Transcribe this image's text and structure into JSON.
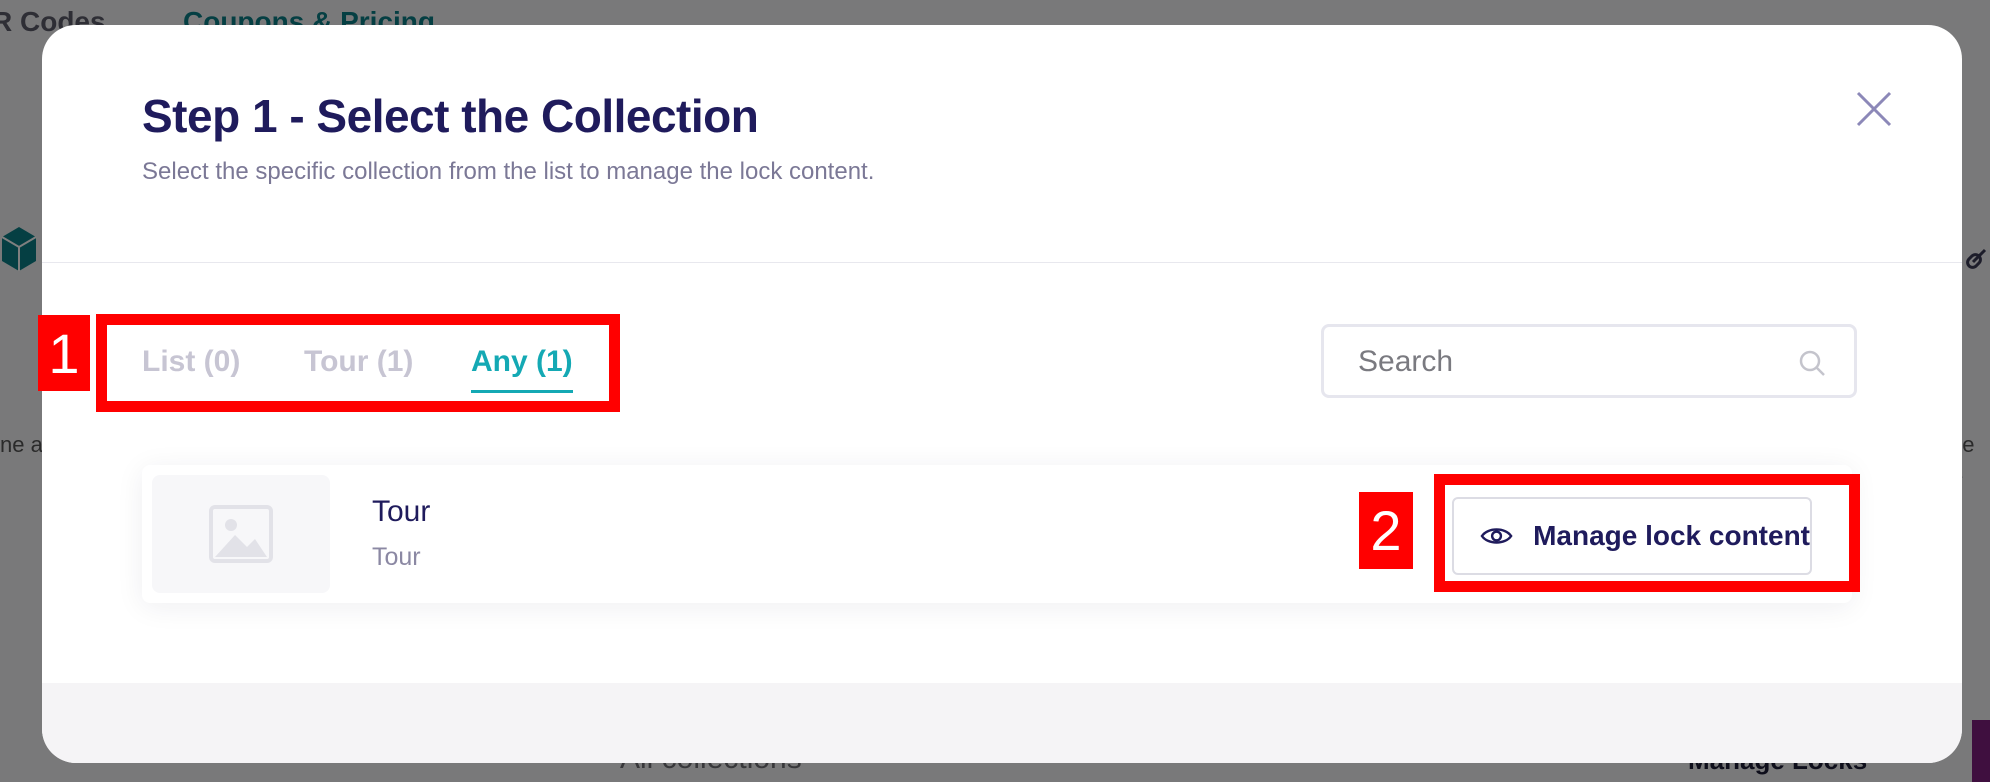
{
  "background": {
    "tabs": [
      "R Codes",
      "Coupons & Pricing"
    ],
    "bottom_search_placeholder": "All collections",
    "manage_locks_label": "Manage Locks",
    "side_text_left": "ne ap",
    "side_text_right": "ne a"
  },
  "modal": {
    "title": "Step 1 - Select the Collection",
    "subtitle": "Select the specific collection from the list to manage the lock content.",
    "close_icon": "close-icon",
    "tabs": [
      {
        "label": "List (0)",
        "active": false
      },
      {
        "label": "Tour (1)",
        "active": false
      },
      {
        "label": "Any (1)",
        "active": true
      }
    ],
    "search": {
      "placeholder": "Search",
      "value": ""
    },
    "collections": [
      {
        "title": "Tour",
        "subtitle": "Tour",
        "thumbnail_icon": "image-placeholder-icon",
        "action_label": "Manage lock content",
        "action_icon": "eye-icon"
      }
    ]
  },
  "annotations": [
    "1",
    "2"
  ],
  "colors": {
    "accent": "#14a9b4",
    "title": "#1f1b5c",
    "annotation": "#ff0000",
    "overlay_page": "#7a7a7a"
  }
}
